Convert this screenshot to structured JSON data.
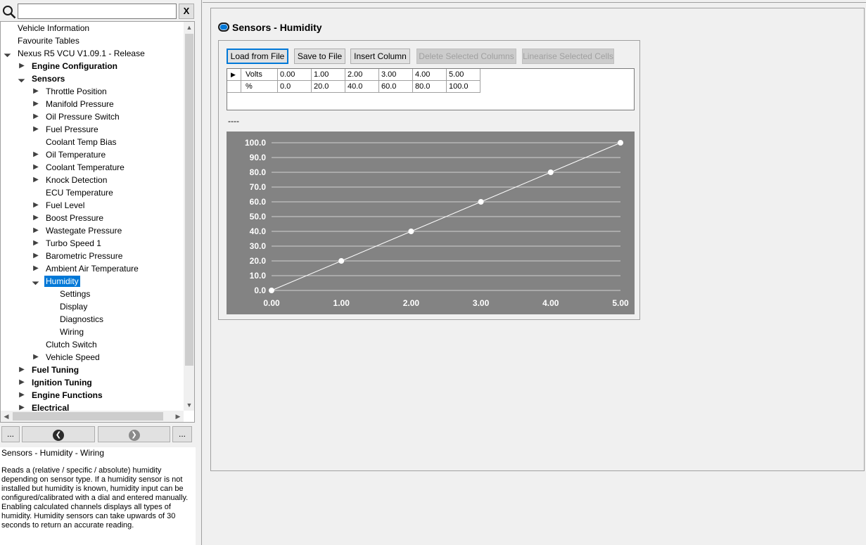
{
  "search": {
    "value": "",
    "clear_label": "X"
  },
  "tree": {
    "items": [
      {
        "label": "Vehicle Information",
        "arrow": ""
      },
      {
        "label": "Favourite Tables",
        "arrow": ""
      },
      {
        "label": "Nexus R5 VCU V1.09.1 - Release",
        "arrow": "expanded"
      },
      {
        "label": "Engine Configuration",
        "arrow": "collapsed"
      },
      {
        "label": "Sensors",
        "arrow": "expanded"
      },
      {
        "label": "Throttle Position",
        "arrow": "collapsed"
      },
      {
        "label": "Manifold Pressure",
        "arrow": "collapsed"
      },
      {
        "label": "Oil Pressure Switch",
        "arrow": "collapsed"
      },
      {
        "label": "Fuel Pressure",
        "arrow": "collapsed"
      },
      {
        "label": "Coolant Temp Bias",
        "arrow": ""
      },
      {
        "label": "Oil Temperature",
        "arrow": "collapsed"
      },
      {
        "label": "Coolant Temperature",
        "arrow": "collapsed"
      },
      {
        "label": "Knock Detection",
        "arrow": "collapsed"
      },
      {
        "label": "ECU Temperature",
        "arrow": ""
      },
      {
        "label": "Fuel Level",
        "arrow": "collapsed"
      },
      {
        "label": "Boost Pressure",
        "arrow": "collapsed"
      },
      {
        "label": "Wastegate Pressure",
        "arrow": "collapsed"
      },
      {
        "label": "Turbo Speed 1",
        "arrow": "collapsed"
      },
      {
        "label": "Barometric Pressure",
        "arrow": "collapsed"
      },
      {
        "label": "Ambient Air Temperature",
        "arrow": "collapsed"
      },
      {
        "label": "Humidity",
        "arrow": "expanded",
        "selected": true
      },
      {
        "label": "Settings",
        "arrow": ""
      },
      {
        "label": "Display",
        "arrow": ""
      },
      {
        "label": "Diagnostics",
        "arrow": ""
      },
      {
        "label": "Wiring",
        "arrow": ""
      },
      {
        "label": "Clutch Switch",
        "arrow": ""
      },
      {
        "label": "Vehicle Speed",
        "arrow": "collapsed"
      },
      {
        "label": "Fuel Tuning",
        "arrow": "collapsed"
      },
      {
        "label": "Ignition Tuning",
        "arrow": "collapsed"
      },
      {
        "label": "Engine Functions",
        "arrow": "collapsed"
      },
      {
        "label": "Electrical",
        "arrow": "collapsed"
      }
    ]
  },
  "nav": {
    "more_left": "...",
    "more_right": "..."
  },
  "help": {
    "title": "Sensors - Humidity - Wiring",
    "body": "Reads a (relative / specific / absolute) humidity depending on sensor type. If a humidity sensor is not installed but humidity is known, humidity input can be configured/calibrated with a dial and entered manually. Enabling calculated channels displays all types of humidity. Humidity sensors can take upwards of 30 seconds to return an accurate reading."
  },
  "panel": {
    "title": "Sensors - Humidity",
    "toolbar": {
      "load": "Load from File",
      "save": "Save to File",
      "insert": "Insert Column",
      "delete": "Delete Selected Columns",
      "linearise": "Linearise Selected Cells"
    },
    "grid": {
      "rows": [
        {
          "label": "Volts",
          "cells": [
            "0.00",
            "1.00",
            "2.00",
            "3.00",
            "4.00",
            "5.00"
          ]
        },
        {
          "label": "%",
          "cells": [
            "0.0",
            "20.0",
            "40.0",
            "60.0",
            "80.0",
            "100.0"
          ]
        }
      ]
    },
    "chart_label": "----"
  },
  "chart_data": {
    "type": "line",
    "x": [
      0.0,
      1.0,
      2.0,
      3.0,
      4.0,
      5.0
    ],
    "series": [
      {
        "values": [
          0.0,
          20.0,
          40.0,
          60.0,
          80.0,
          100.0
        ]
      }
    ],
    "x_ticks": [
      "0.00",
      "1.00",
      "2.00",
      "3.00",
      "4.00",
      "5.00"
    ],
    "y_ticks": [
      "0.0",
      "10.0",
      "20.0",
      "30.0",
      "40.0",
      "50.0",
      "60.0",
      "70.0",
      "80.0",
      "90.0",
      "100.0"
    ],
    "xlim": [
      0,
      5
    ],
    "ylim": [
      0,
      100
    ],
    "grid": true,
    "colors": {
      "background": "#838383",
      "line": "#ffffff",
      "gridline": "#ffffff"
    }
  }
}
